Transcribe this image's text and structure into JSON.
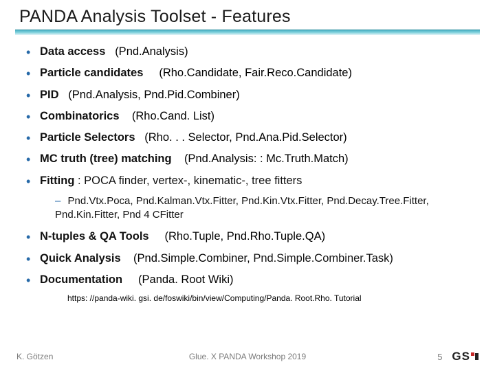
{
  "title": "PANDA Analysis Toolset - Features",
  "items": [
    {
      "label": "Data access",
      "paren": "(Pnd.Analysis)"
    },
    {
      "label": "Particle candidates",
      "paren": "(Rho.Candidate, Fair.Reco.Candidate)"
    },
    {
      "label": "PID",
      "paren": "(Pnd.Analysis, Pnd.Pid.Combiner)"
    },
    {
      "label": "Combinatorics",
      "paren": "(Rho.Cand. List)"
    },
    {
      "label": "Particle  Selectors",
      "paren": "(Rho. . . Selector, Pnd.Ana.Pid.Selector)"
    },
    {
      "label": "MC truth  (tree) matching",
      "paren": "(Pnd.Analysis: : Mc.Truth.Match)"
    },
    {
      "label": "Fitting",
      "tail": " : POCA finder, vertex-, kinematic-, tree fitters"
    }
  ],
  "fitters_sub": "Pnd.Vtx.Poca, Pnd.Kalman.Vtx.Fitter, Pnd.Kin.Vtx.Fitter, Pnd.Decay.Tree.Fitter, Pnd.Kin.Fitter, Pnd 4 CFitter",
  "items2": [
    {
      "label": "N-tuples & QA Tools",
      "paren": "(Rho.Tuple, Pnd.Rho.Tuple.QA)"
    },
    {
      "label": "Quick Analysis",
      "paren": "(Pnd.Simple.Combiner,",
      "trail": "Pnd.Simple.Combiner.Task)"
    }
  ],
  "doc": {
    "label": "Documentation",
    "paren": "(Panda. Root Wiki)"
  },
  "url": "https: //panda-wiki. gsi. de/foswiki/bin/view/Computing/Panda. Root.Rho. Tutorial",
  "footer": {
    "author": "K. Götzen",
    "venue": "Glue. X PANDA Workshop 2019",
    "page": "5",
    "logo": "GSI"
  },
  "dash": "–"
}
